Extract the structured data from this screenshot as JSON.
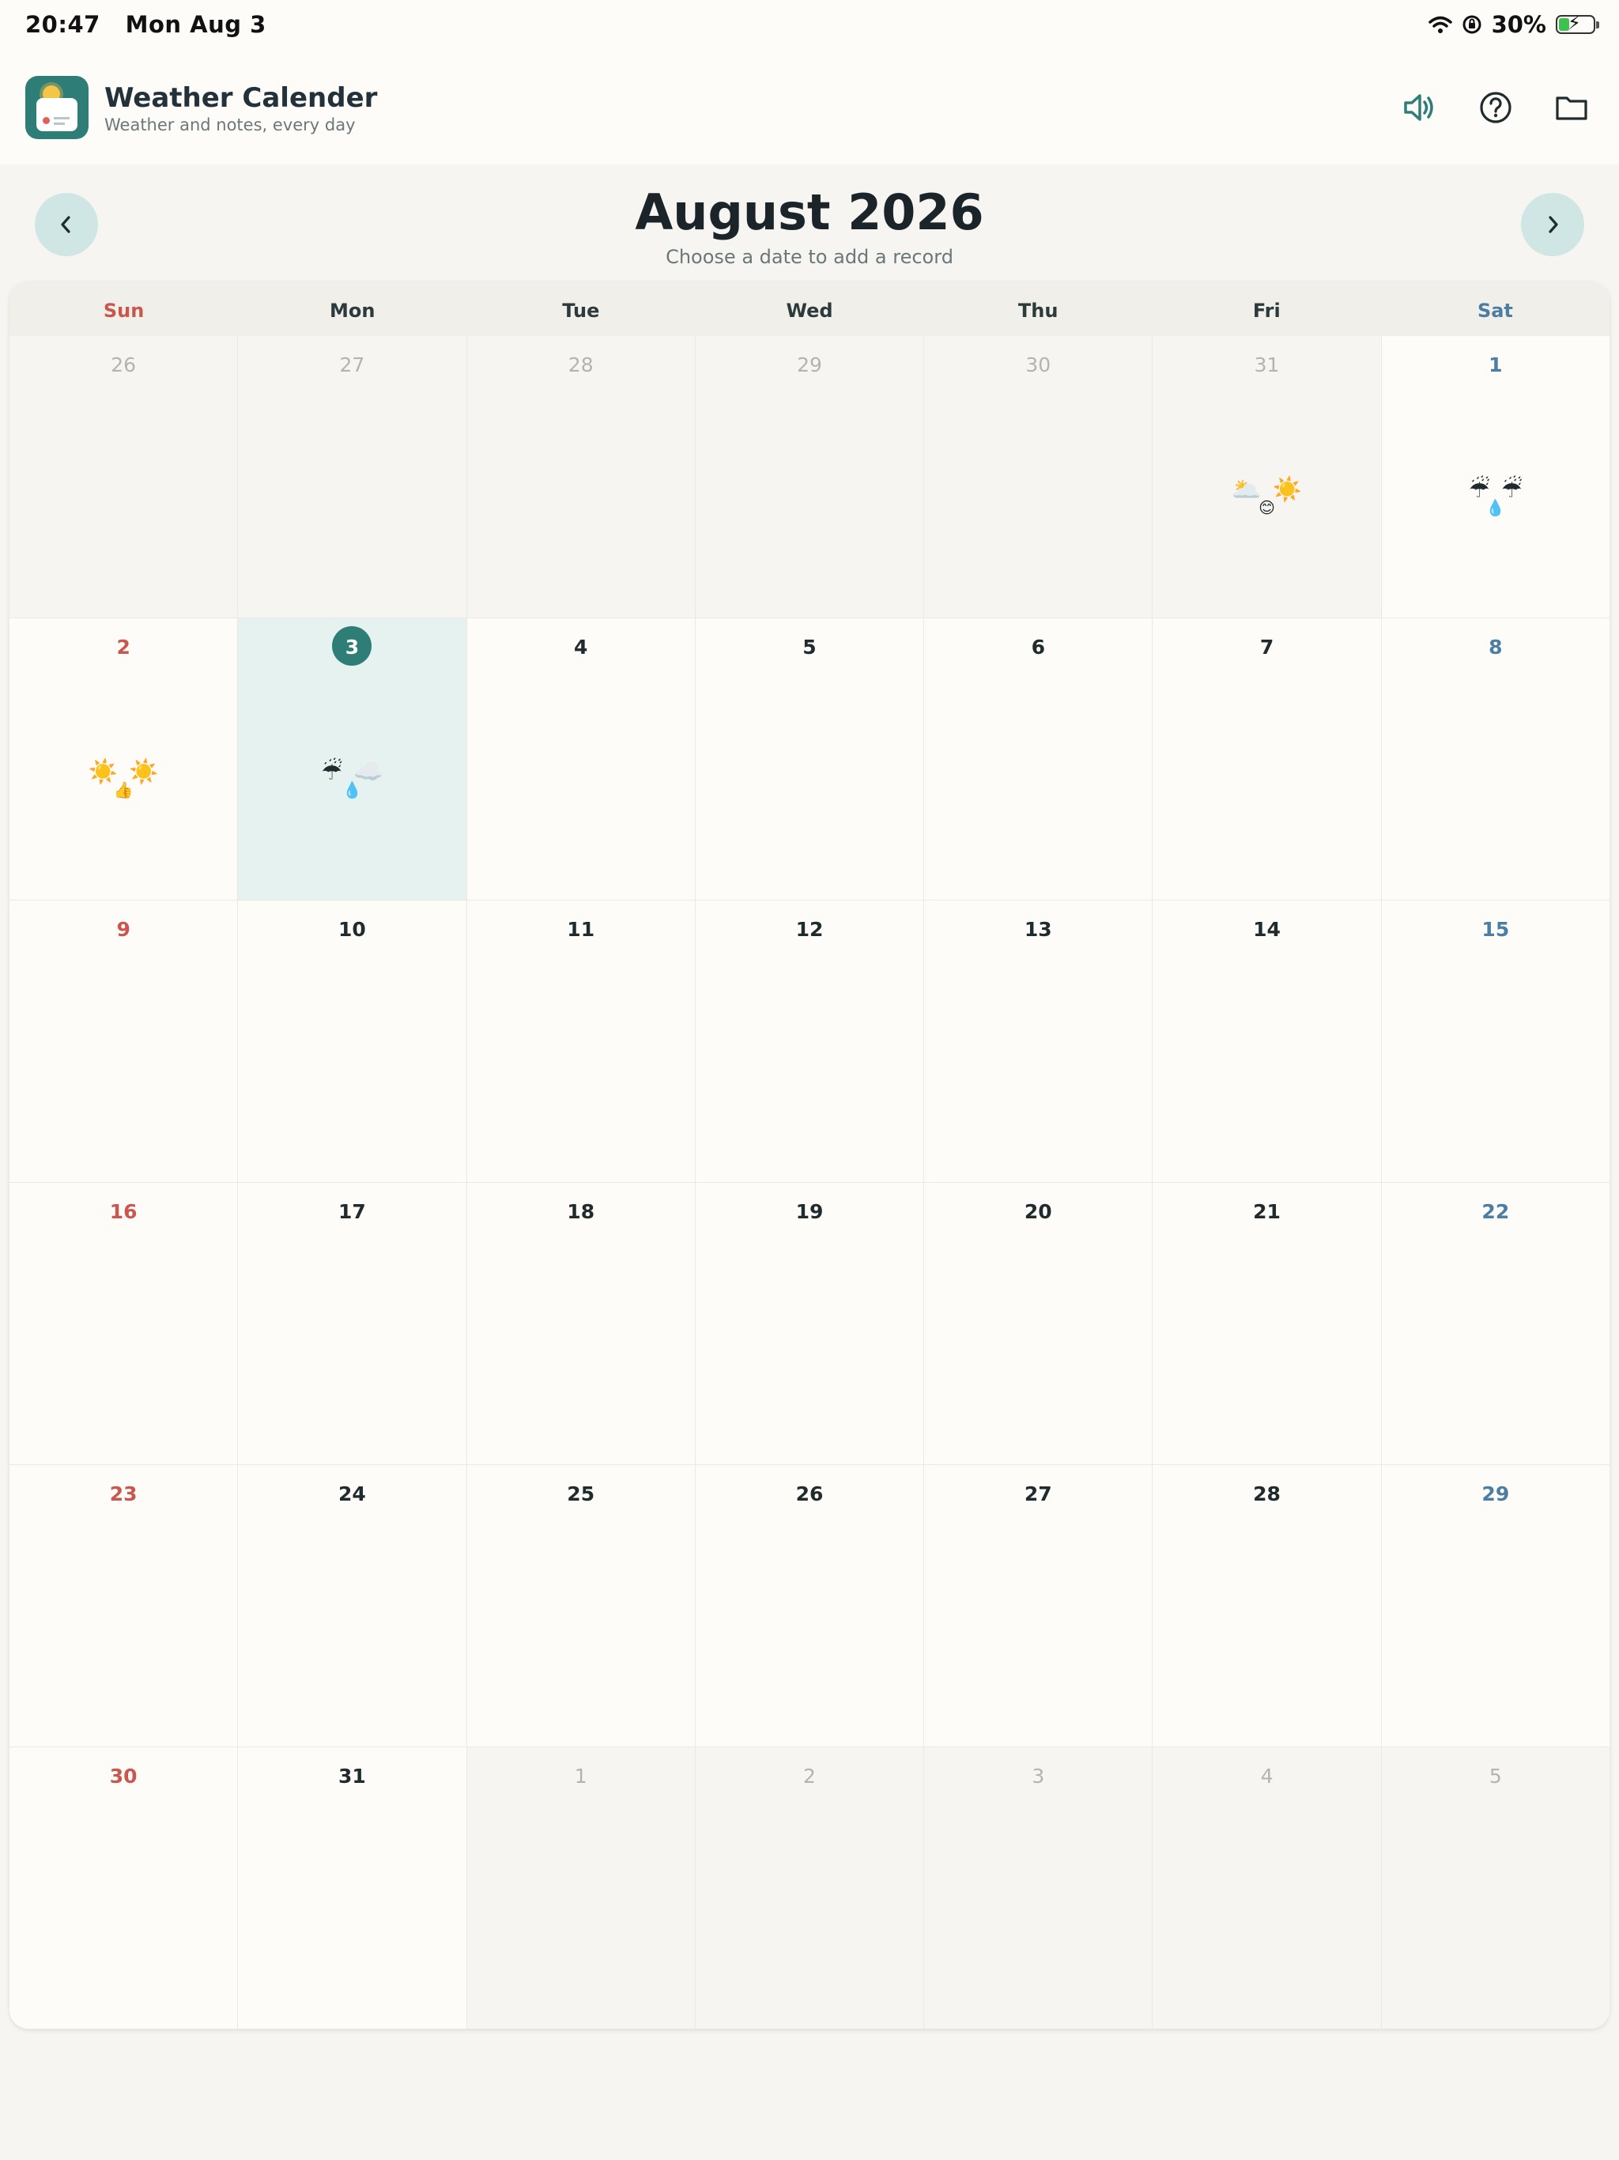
{
  "status_bar": {
    "time": "20:47",
    "date": "Mon Aug 3",
    "battery": "30%",
    "battery_level": 0.3
  },
  "app": {
    "title": "Weather Calender",
    "subtitle": "Weather and notes, every day",
    "accent_color": "#2f7d77"
  },
  "header_actions": {
    "sound_icon": "speaker-icon",
    "help_icon": "question-icon",
    "folder_icon": "folder-icon"
  },
  "calendar": {
    "month_title": "August 2026",
    "subtitle": "Choose a date to add a record",
    "weekdays": [
      "Sun",
      "Mon",
      "Tue",
      "Wed",
      "Thu",
      "Fri",
      "Sat"
    ],
    "weeks": [
      [
        {
          "day": "26",
          "other": true
        },
        {
          "day": "27",
          "other": true
        },
        {
          "day": "28",
          "other": true
        },
        {
          "day": "29",
          "other": true
        },
        {
          "day": "30",
          "other": true
        },
        {
          "day": "31",
          "other": true,
          "weather": [
            "🌥️",
            "☀️"
          ],
          "mood": "😊"
        },
        {
          "day": "1",
          "weather": [
            "☔",
            "☔"
          ],
          "mood": "💧"
        }
      ],
      [
        {
          "day": "2",
          "weather": [
            "☀️",
            "☀️"
          ],
          "mood": "👍"
        },
        {
          "day": "3",
          "today": true,
          "weather": [
            "☔",
            "☁️"
          ],
          "mood": "💧"
        },
        {
          "day": "4"
        },
        {
          "day": "5"
        },
        {
          "day": "6"
        },
        {
          "day": "7"
        },
        {
          "day": "8"
        }
      ],
      [
        {
          "day": "9"
        },
        {
          "day": "10"
        },
        {
          "day": "11"
        },
        {
          "day": "12"
        },
        {
          "day": "13"
        },
        {
          "day": "14"
        },
        {
          "day": "15"
        }
      ],
      [
        {
          "day": "16"
        },
        {
          "day": "17"
        },
        {
          "day": "18"
        },
        {
          "day": "19"
        },
        {
          "day": "20"
        },
        {
          "day": "21"
        },
        {
          "day": "22"
        }
      ],
      [
        {
          "day": "23"
        },
        {
          "day": "24"
        },
        {
          "day": "25"
        },
        {
          "day": "26"
        },
        {
          "day": "27"
        },
        {
          "day": "28"
        },
        {
          "day": "29"
        }
      ],
      [
        {
          "day": "30"
        },
        {
          "day": "31"
        },
        {
          "day": "1",
          "other": true
        },
        {
          "day": "2",
          "other": true
        },
        {
          "day": "3",
          "other": true
        },
        {
          "day": "4",
          "other": true
        },
        {
          "day": "5",
          "other": true
        }
      ]
    ]
  }
}
